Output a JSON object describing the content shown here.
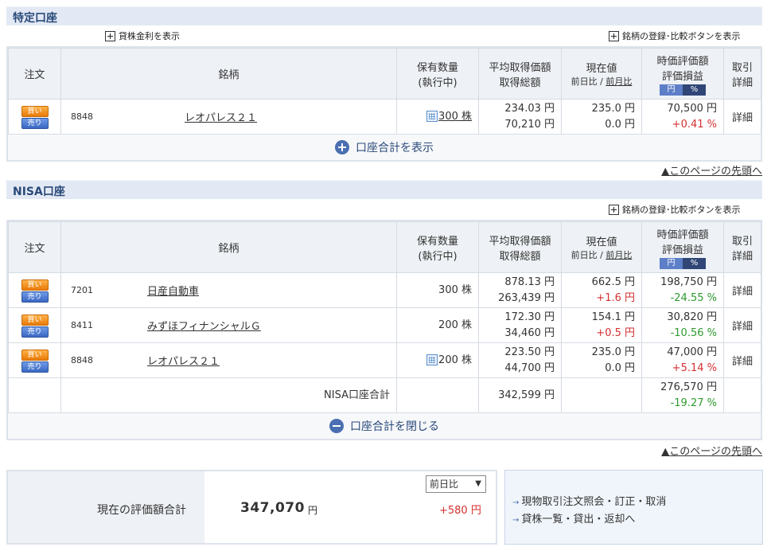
{
  "sections": {
    "tokutei": {
      "title": "特定口座",
      "lend_rate_link": "貸株金利を表示",
      "compare_link": "銘柄の登録･比較ボタンを表示",
      "toggle_label": "口座合計を表示",
      "rows": [
        {
          "code": "8848",
          "name": "レオパレス２１",
          "qty": "300 株",
          "avg": "234.03 円",
          "cost": "70,210 円",
          "price": "235.0 円",
          "chg": "0.0 円",
          "value": "70,500 円",
          "pl": "+0.41 %"
        }
      ]
    },
    "nisa": {
      "title": "NISA口座",
      "compare_link": "銘柄の登録･比較ボタンを表示",
      "toggle_label": "口座合計を閉じる",
      "rows": [
        {
          "code": "7201",
          "name": "日産自動車",
          "qty": "300 株",
          "avg": "878.13 円",
          "cost": "263,439 円",
          "price": "662.5 円",
          "chg": "+1.6 円",
          "value": "198,750 円",
          "pl": "-24.55 %"
        },
        {
          "code": "8411",
          "name": "みずほフィナンシャルＧ",
          "qty": "200 株",
          "avg": "172.30 円",
          "cost": "34,460 円",
          "price": "154.1 円",
          "chg": "+0.5 円",
          "value": "30,820 円",
          "pl": "-10.56 %"
        },
        {
          "code": "8848",
          "name": "レオパレス２１",
          "qty": "200 株",
          "avg": "223.50 円",
          "cost": "44,700 円",
          "price": "235.0 円",
          "chg": "0.0 円",
          "value": "47,000 円",
          "pl": "+5.14 %"
        }
      ],
      "summary": {
        "label": "NISA口座合計",
        "cost": "342,599 円",
        "value": "276,570 円",
        "pl": "-19.27 %"
      }
    }
  },
  "headers": {
    "order": "注文",
    "name": "銘柄",
    "qty1": "保有数量",
    "qty2": "(執行中)",
    "avg1": "平均取得価額",
    "avg2": "取得総額",
    "price1": "現在値",
    "price_day": "前日比",
    "price_sep": " / ",
    "price_month": "前月比",
    "val1": "時価評価額",
    "val2": "評価損益",
    "yen": "円",
    "pct": "%",
    "trade1": "取引",
    "trade2": "詳細"
  },
  "buttons": {
    "buy": "買い",
    "sell": "売り",
    "detail": "詳細"
  },
  "back_to_top": "▲このページの先頭へ",
  "total": {
    "label": "現在の評価額合計",
    "value": "347,070",
    "unit": "円",
    "select_value": "前日比",
    "diff": "+580 円"
  },
  "links": [
    "現物取引注文照会・訂正・取消",
    "貸株一覧・貸出・返却へ"
  ],
  "colors": {
    "accent": "#2a4a7a",
    "positive": "#d43030",
    "negative": "#2d9a2d"
  }
}
